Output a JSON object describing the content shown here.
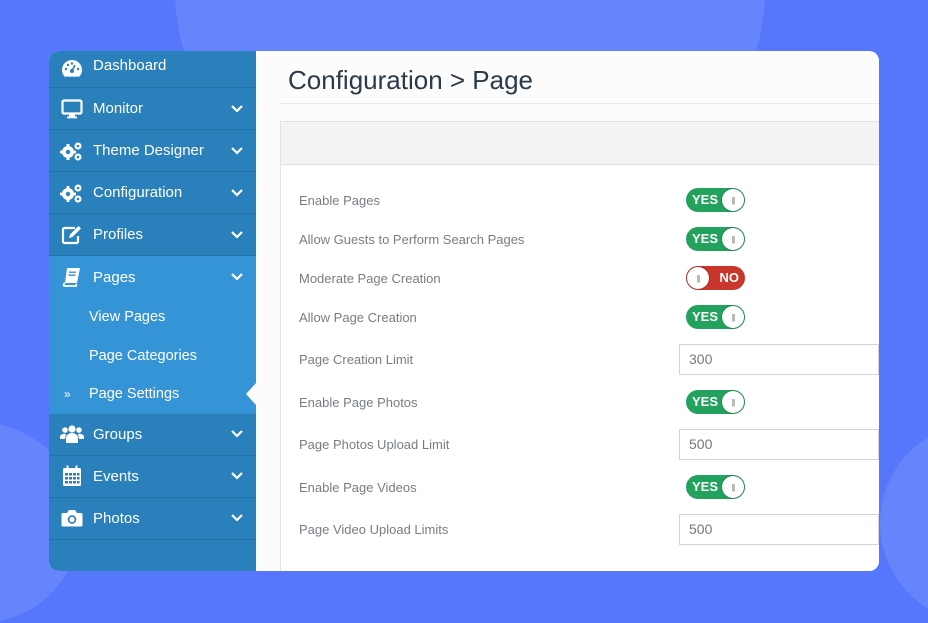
{
  "sidebar": {
    "items": [
      {
        "label": "Dashboard",
        "icon": "dashboard-icon",
        "has_chevron": false
      },
      {
        "label": "Monitor",
        "icon": "monitor-icon",
        "has_chevron": true
      },
      {
        "label": "Theme Designer",
        "icon": "cogs-icon",
        "has_chevron": true
      },
      {
        "label": "Configuration",
        "icon": "cogs-icon",
        "has_chevron": true
      },
      {
        "label": "Profiles",
        "icon": "edit-icon",
        "has_chevron": true
      },
      {
        "label": "Pages",
        "icon": "book-icon",
        "has_chevron": true,
        "active": true
      },
      {
        "label": "Groups",
        "icon": "users-icon",
        "has_chevron": true
      },
      {
        "label": "Events",
        "icon": "calendar-icon",
        "has_chevron": true
      },
      {
        "label": "Photos",
        "icon": "camera-icon",
        "has_chevron": true
      }
    ],
    "pages_submenu": [
      {
        "label": "View Pages"
      },
      {
        "label": "Page Categories"
      },
      {
        "label": "Page Settings",
        "current": true,
        "marker": "»"
      }
    ]
  },
  "main": {
    "title": "Configuration > Page",
    "settings": [
      {
        "label": "Enable Pages",
        "type": "toggle",
        "value": "YES"
      },
      {
        "label": "Allow Guests to Perform Search Pages",
        "type": "toggle",
        "value": "YES"
      },
      {
        "label": "Moderate Page Creation",
        "type": "toggle",
        "value": "NO"
      },
      {
        "label": "Allow Page Creation",
        "type": "toggle",
        "value": "YES"
      },
      {
        "label": "Page Creation Limit",
        "type": "input",
        "value": "300"
      },
      {
        "label": "Enable Page Photos",
        "type": "toggle",
        "value": "YES"
      },
      {
        "label": "Page Photos Upload Limit",
        "type": "input",
        "value": "500"
      },
      {
        "label": "Enable Page Videos",
        "type": "toggle",
        "value": "YES"
      },
      {
        "label": "Page Video Upload Limits",
        "type": "input",
        "value": "500"
      }
    ],
    "toggle_knob_glyph": "|||"
  },
  "colors": {
    "background": "#5677fb",
    "sidebar": "#2a80bb",
    "sidebar_active": "#3594d6",
    "toggle_on": "#23a25e",
    "toggle_off": "#c8362c"
  }
}
